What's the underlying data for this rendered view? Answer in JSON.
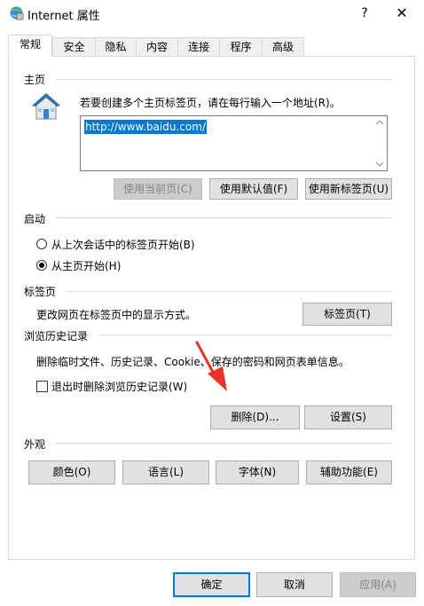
{
  "window": {
    "title": "Internet 属性",
    "help_label": "?",
    "close_label": "✕"
  },
  "tabs": [
    {
      "label": "常规",
      "active": true
    },
    {
      "label": "安全"
    },
    {
      "label": "隐私"
    },
    {
      "label": "内容"
    },
    {
      "label": "连接"
    },
    {
      "label": "程序"
    },
    {
      "label": "高级"
    }
  ],
  "home": {
    "group_label": "主页",
    "description": "若要创建多个主页标签页，请在每行输入一个地址(R)。",
    "url_value": "http://www.baidu.com/",
    "btn_use_current": "使用当前页(C)",
    "btn_use_default": "使用默认值(F)",
    "btn_use_new_tab": "使用新标签页(U)"
  },
  "startup": {
    "group_label": "启动",
    "option_last_session": "从上次会话中的标签页开始(B)",
    "option_home_page": "从主页开始(H)",
    "selected": "option_home_page"
  },
  "tabs_group": {
    "group_label": "标签页",
    "description": "更改网页在标签页中的显示方式。",
    "btn_tabs": "标签页(T)"
  },
  "history": {
    "group_label": "浏览历史记录",
    "description": "删除临时文件、历史记录、Cookie、保存的密码和网页表单信息。",
    "checkbox_label": "退出时删除浏览历史记录(W)",
    "checkbox_checked": false,
    "btn_delete": "删除(D)...",
    "btn_settings": "设置(S)"
  },
  "appearance": {
    "group_label": "外观",
    "btn_colors": "颜色(O)",
    "btn_languages": "语言(L)",
    "btn_fonts": "字体(N)",
    "btn_accessibility": "辅助功能(E)"
  },
  "footer": {
    "btn_ok": "确定",
    "btn_cancel": "取消",
    "btn_apply": "应用(A)"
  },
  "colors": {
    "accent": "#0078d7",
    "annotation_arrow": "#e8322a"
  }
}
